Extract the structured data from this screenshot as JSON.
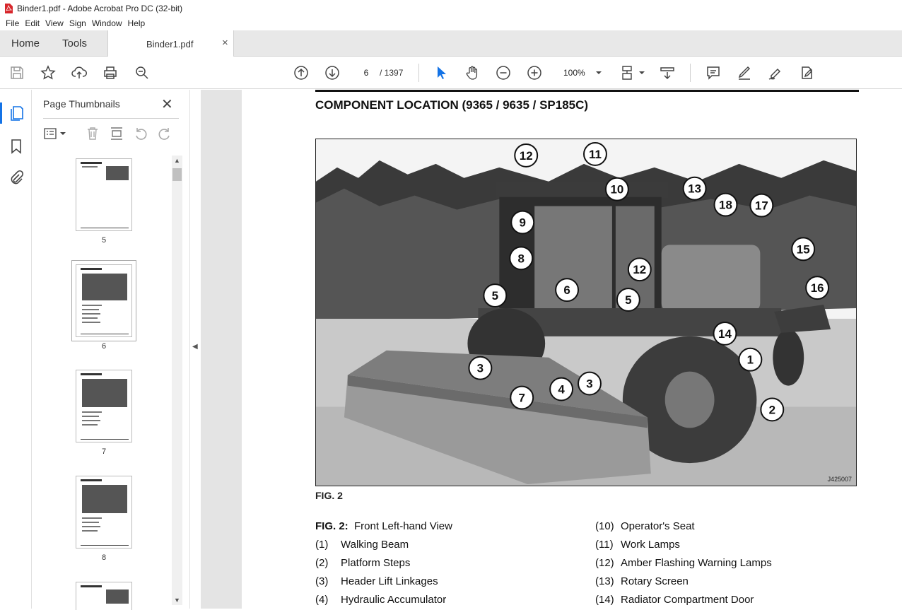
{
  "window": {
    "title": "Binder1.pdf - Adobe Acrobat Pro DC (32-bit)"
  },
  "menu": [
    "File",
    "Edit",
    "View",
    "Sign",
    "Window",
    "Help"
  ],
  "tabs": {
    "home": "Home",
    "tools": "Tools",
    "document": "Binder1.pdf",
    "close": "×"
  },
  "toolbar": {
    "current_page": "6",
    "total_pages": "/ 1397",
    "zoom": "100%"
  },
  "panel": {
    "title": "Page Thumbnails",
    "close": "✕",
    "thumbnails": [
      {
        "label": "5"
      },
      {
        "label": "6",
        "selected": true
      },
      {
        "label": "7"
      },
      {
        "label": "8"
      }
    ]
  },
  "document": {
    "heading": "COMPONENT LOCATION (9365 / 9635 / SP185C)",
    "figure_label": "FIG. 2",
    "image_code": "J425007",
    "callouts": [
      "12",
      "11",
      "10",
      "13",
      "18",
      "17",
      "9",
      "15",
      "8",
      "12",
      "16",
      "5",
      "6",
      "5",
      "14",
      "1",
      "3",
      "4",
      "3",
      "7",
      "2"
    ],
    "caption_prefix": "FIG. 2:",
    "caption_title": "Front Left-hand View",
    "legend_left": [
      {
        "num": "(1)",
        "text": "Walking Beam"
      },
      {
        "num": "(2)",
        "text": "Platform Steps"
      },
      {
        "num": "(3)",
        "text": "Header Lift Linkages"
      },
      {
        "num": "(4)",
        "text": "Hydraulic Accumulator"
      }
    ],
    "legend_right": [
      {
        "num": "(10)",
        "text": "Operator's Seat"
      },
      {
        "num": "(11)",
        "text": "Work Lamps"
      },
      {
        "num": "(12)",
        "text": "Amber Flashing Warning Lamps"
      },
      {
        "num": "(13)",
        "text": "Rotary Screen"
      },
      {
        "num": "(14)",
        "text": "Radiator Compartment Door"
      }
    ]
  },
  "colors": {
    "accent": "#1473e6",
    "pdf_red": "#d7262b"
  }
}
